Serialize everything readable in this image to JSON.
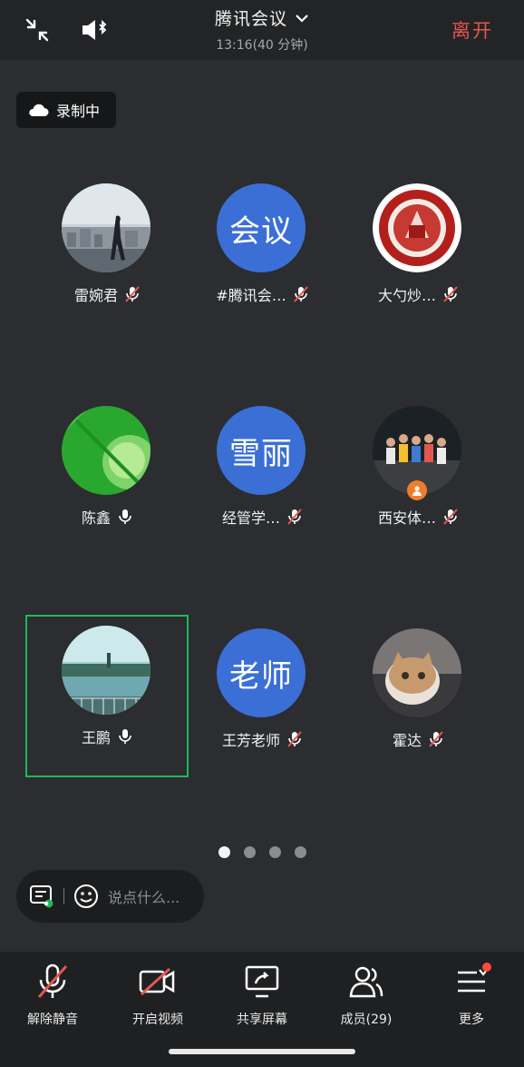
{
  "header": {
    "title": "腾讯会议",
    "time": "13:16(40 分钟)",
    "leave_label": "离开"
  },
  "recording": {
    "label": "录制中"
  },
  "participants": [
    {
      "name": "雷婉君",
      "avatar": "photo",
      "mic": "muted"
    },
    {
      "name": "#腾讯会…",
      "avatar_text": "会议",
      "mic": "muted"
    },
    {
      "name": "大勺炒…",
      "avatar": "seal",
      "mic": "muted"
    },
    {
      "name": "陈鑫",
      "avatar": "green",
      "mic": "on"
    },
    {
      "name": "经管学…",
      "avatar_text": "雪丽",
      "mic": "muted"
    },
    {
      "name": "西安体…",
      "avatar": "group-photo",
      "mic": "muted",
      "host_badge": true
    },
    {
      "name": "王鹏",
      "avatar": "lake",
      "mic": "on",
      "selected": true
    },
    {
      "name": "王芳老师",
      "avatar_text": "老师",
      "mic": "muted"
    },
    {
      "name": "霍达",
      "avatar": "cat",
      "mic": "muted"
    }
  ],
  "pagination": {
    "total": 4,
    "active": 1
  },
  "chat": {
    "placeholder": "说点什么..."
  },
  "toolbar": {
    "unmute": "解除静音",
    "video": "开启视频",
    "share": "共享屏幕",
    "members": "成员(29)",
    "more": "更多"
  },
  "colors": {
    "accent_red": "#e35751",
    "avatar_blue": "#3b6fd6",
    "selected_green": "#1fb85a"
  }
}
